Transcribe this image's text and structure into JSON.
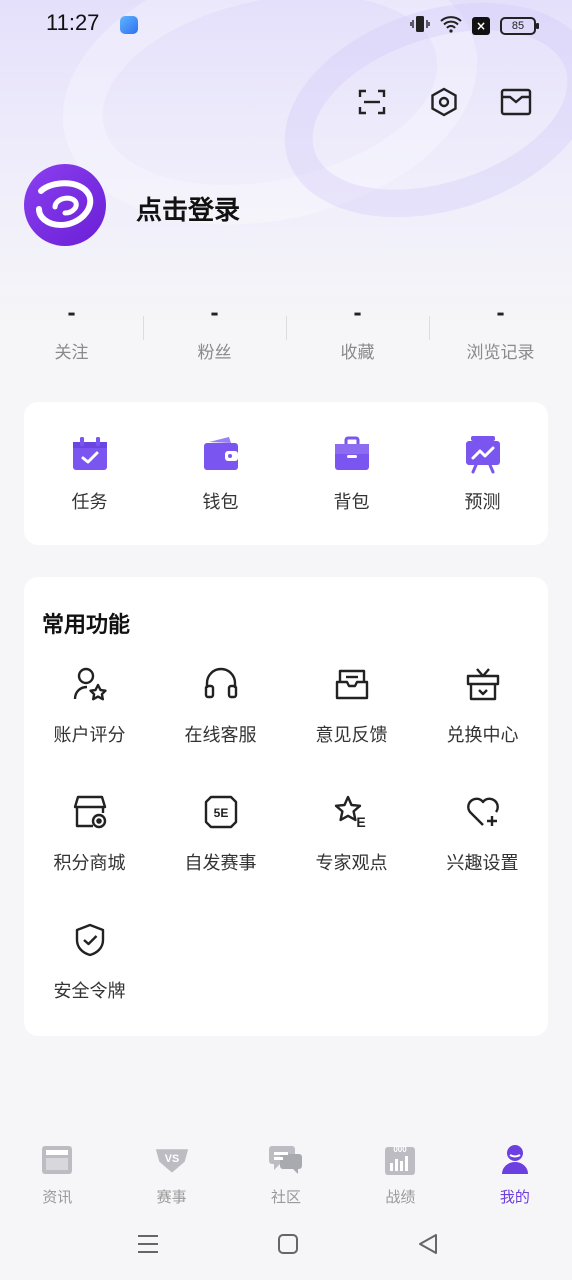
{
  "status_bar": {
    "time": "11:27",
    "battery": "85",
    "sim_label": "×"
  },
  "colors": {
    "accent": "#6c3fe0",
    "icon_purple": "#7a55ef",
    "inactive": "#999999"
  },
  "top_actions": [
    {
      "name": "scan-icon"
    },
    {
      "name": "settings-hex-icon"
    },
    {
      "name": "message-icon"
    }
  ],
  "profile": {
    "login_text": "点击登录"
  },
  "stats": [
    {
      "value": "-",
      "label": "关注"
    },
    {
      "value": "-",
      "label": "粉丝"
    },
    {
      "value": "-",
      "label": "收藏"
    },
    {
      "value": "-",
      "label": "浏览记录"
    }
  ],
  "quick": [
    {
      "label": "任务",
      "icon": "calendar-check-icon"
    },
    {
      "label": "钱包",
      "icon": "wallet-icon"
    },
    {
      "label": "背包",
      "icon": "bag-icon"
    },
    {
      "label": "预测",
      "icon": "chart-board-icon"
    }
  ],
  "common": {
    "title": "常用功能",
    "items": [
      {
        "label": "账户评分",
        "icon": "user-star-icon"
      },
      {
        "label": "在线客服",
        "icon": "headset-icon"
      },
      {
        "label": "意见反馈",
        "icon": "inbox-icon"
      },
      {
        "label": "兑换中心",
        "icon": "gift-box-icon"
      },
      {
        "label": "积分商城",
        "icon": "shop-icon"
      },
      {
        "label": "自发赛事",
        "icon": "5e-badge-icon"
      },
      {
        "label": "专家观点",
        "icon": "star-e-icon"
      },
      {
        "label": "兴趣设置",
        "icon": "heart-plus-icon"
      },
      {
        "label": "安全令牌",
        "icon": "shield-check-icon"
      }
    ]
  },
  "bottom_nav": [
    {
      "label": "资讯",
      "icon": "news-icon",
      "active": false
    },
    {
      "label": "赛事",
      "icon": "vs-icon",
      "active": false
    },
    {
      "label": "社区",
      "icon": "chat-icon",
      "active": false
    },
    {
      "label": "战绩",
      "icon": "stats-icon",
      "active": false
    },
    {
      "label": "我的",
      "icon": "profile-icon",
      "active": true
    }
  ],
  "vs_text": "VS",
  "badge_5e": "5E",
  "stats_digits": "000",
  "star_letter": "E"
}
